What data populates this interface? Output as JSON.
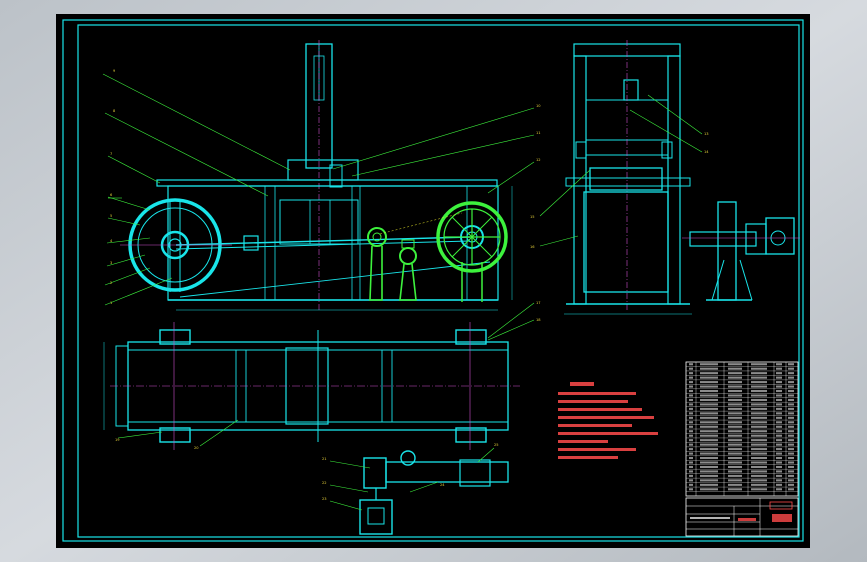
{
  "drawing": {
    "type": "mechanical-assembly-drawing",
    "background_color": "#000000",
    "line_color_primary": "#19e4e9",
    "line_color_secondary": "#3df23d",
    "centerline_color": "#d04fd0",
    "annotation_color": "#e8d23a",
    "notes_color": "#ff4b4b"
  },
  "views": [
    {
      "name": "front-view"
    },
    {
      "name": "side-view"
    },
    {
      "name": "top-view"
    },
    {
      "name": "motor-drive-detail"
    }
  ],
  "technical_notes": {
    "lines_count": 8
  },
  "parts_list": {
    "rows": 30
  },
  "title_block": {
    "present": true
  }
}
